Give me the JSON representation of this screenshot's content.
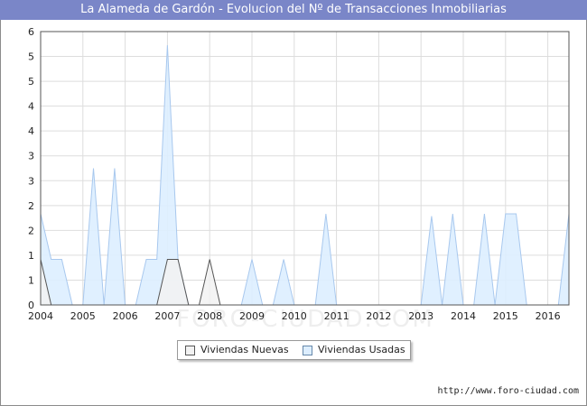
{
  "title": "La Alameda de Gardón - Evolucion del Nº de Transacciones Inmobiliarias",
  "footer": "http://www.foro-ciudad.com",
  "watermark": "FORO-CIUDAD.COM",
  "colors": {
    "title_bg": "#7a86c8",
    "nuevas_fill": "#f2f2f2",
    "nuevas_line": "#555555",
    "usadas_fill": "#ddeeff",
    "usadas_line": "#a8c8ee",
    "grid": "#dddddd"
  },
  "chart_data": {
    "type": "area",
    "title": "La Alameda de Gardón - Evolucion del Nº de Transacciones Inmobiliarias",
    "xlabel": "",
    "ylabel": "",
    "xlim": [
      2004,
      2016.5
    ],
    "ylim": [
      0,
      6
    ],
    "x_ticks": [
      "2004",
      "2005",
      "2006",
      "2007",
      "2008",
      "2009",
      "2010",
      "2011",
      "2012",
      "2013",
      "2014",
      "2015",
      "2016"
    ],
    "y_ticks": [
      "0",
      "1",
      "1",
      "2",
      "2",
      "3",
      "3",
      "4",
      "4",
      "5",
      "5",
      "6"
    ],
    "grid": true,
    "legend": "bottom-center",
    "series": [
      {
        "name": "Viviendas Nuevas",
        "points": [
          [
            2004,
            1
          ],
          [
            2004.25,
            0
          ],
          [
            2006.75,
            0
          ],
          [
            2007,
            1
          ],
          [
            2007.25,
            1
          ],
          [
            2007.5,
            0
          ],
          [
            2007.75,
            0
          ],
          [
            2008,
            1
          ],
          [
            2008.25,
            0
          ],
          [
            2016.5,
            0
          ]
        ]
      },
      {
        "name": "Viviendas Usadas",
        "points": [
          [
            2004,
            2
          ],
          [
            2004.25,
            1
          ],
          [
            2004.5,
            1
          ],
          [
            2004.75,
            0
          ],
          [
            2005,
            0
          ],
          [
            2005.25,
            3
          ],
          [
            2005.5,
            0
          ],
          [
            2005.75,
            3
          ],
          [
            2006,
            0
          ],
          [
            2006.25,
            0
          ],
          [
            2006.5,
            1
          ],
          [
            2006.75,
            1
          ],
          [
            2007,
            5.7
          ],
          [
            2007.25,
            1
          ],
          [
            2007.5,
            0
          ],
          [
            2008.75,
            0
          ],
          [
            2009,
            1
          ],
          [
            2009.25,
            0
          ],
          [
            2009.5,
            0
          ],
          [
            2009.75,
            1
          ],
          [
            2010,
            0
          ],
          [
            2010.5,
            0
          ],
          [
            2010.75,
            2
          ],
          [
            2011,
            0
          ],
          [
            2013,
            0
          ],
          [
            2013.25,
            1.95
          ],
          [
            2013.5,
            0
          ],
          [
            2013.75,
            2
          ],
          [
            2014,
            0
          ],
          [
            2014.25,
            0
          ],
          [
            2014.5,
            2
          ],
          [
            2014.75,
            0
          ],
          [
            2015,
            2
          ],
          [
            2015.25,
            2
          ],
          [
            2015.5,
            0
          ],
          [
            2016.25,
            0
          ],
          [
            2016.5,
            2
          ]
        ]
      }
    ]
  }
}
